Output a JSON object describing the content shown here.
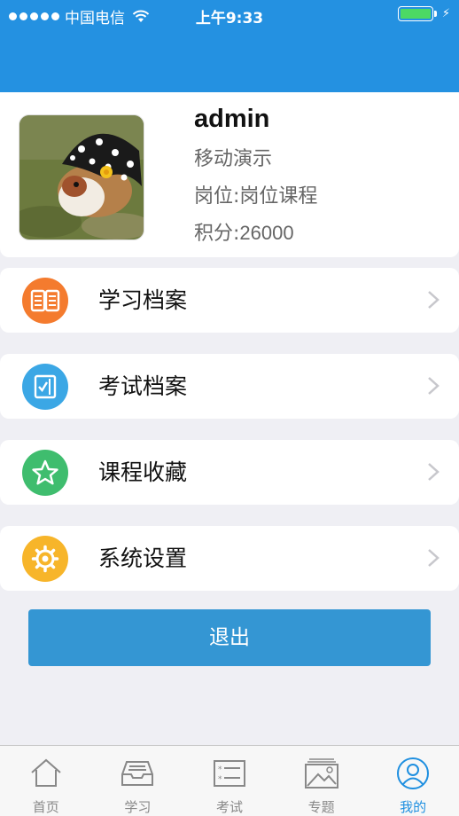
{
  "status_bar": {
    "carrier": "中国电信",
    "time": "上午9:33",
    "signal_bars": 5,
    "battery_level": 1.0
  },
  "profile": {
    "username": "admin",
    "subtitle": "移动演示",
    "position_label": "岗位:",
    "position_value": "岗位课程",
    "points_label": "积分:",
    "points_value": "26000"
  },
  "menu": {
    "items": [
      {
        "label": "学习档案",
        "icon": "book-icon",
        "color": "#f47b2e"
      },
      {
        "label": "考试档案",
        "icon": "exam-checklist-icon",
        "color": "#3ba7e5"
      },
      {
        "label": "课程收藏",
        "icon": "star-icon",
        "color": "#3fbd6e"
      },
      {
        "label": "系统设置",
        "icon": "gear-icon",
        "color": "#f7b52a"
      }
    ]
  },
  "logout_label": "退出",
  "tabbar": {
    "active_index": 4,
    "tabs": [
      {
        "label": "首页",
        "icon": "home-icon"
      },
      {
        "label": "学习",
        "icon": "inbox-tray-icon"
      },
      {
        "label": "考试",
        "icon": "exam-list-icon"
      },
      {
        "label": "专题",
        "icon": "picture-icon"
      },
      {
        "label": "我的",
        "icon": "user-icon"
      }
    ]
  },
  "colors": {
    "header": "#2491e1",
    "logout_button": "#3496d3",
    "tab_active": "#1e8fe0",
    "battery": "#4cd964"
  }
}
